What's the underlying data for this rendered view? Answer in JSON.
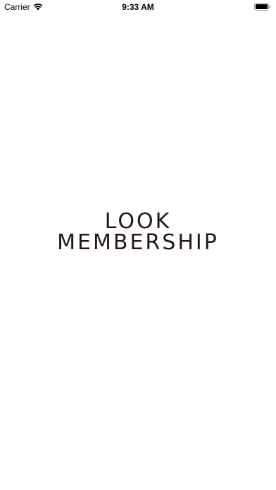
{
  "status_bar": {
    "carrier": "Carrier",
    "time": "9:33 AM",
    "wifi_icon": "wifi-icon",
    "battery_icon": "battery-icon"
  },
  "splash": {
    "logo_line_1": "LOOK",
    "logo_line_2": "MEMBERSHIP",
    "text_color": "#231815",
    "background_color": "#ffffff"
  }
}
